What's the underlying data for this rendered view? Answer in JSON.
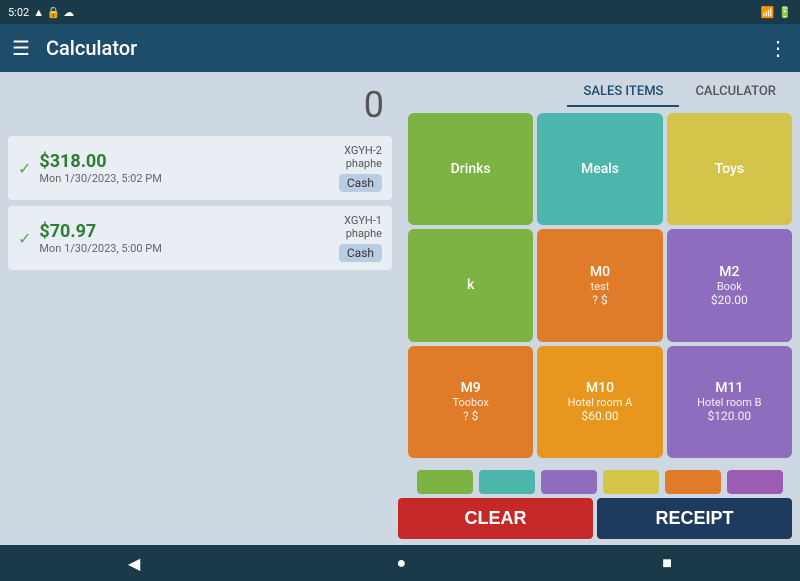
{
  "statusBar": {
    "time": "5:02",
    "batteryIcon": "🔋"
  },
  "topBar": {
    "title": "Calculator",
    "menuIcon": "☰",
    "moreIcon": "⋮"
  },
  "display": {
    "amount": "0"
  },
  "transactions": [
    {
      "amount": "$318.00",
      "date": "Mon 1/30/2023, 5:02 PM",
      "id": "XGYH-2",
      "user": "phaphe",
      "payment": "Cash"
    },
    {
      "amount": "$70.97",
      "date": "Mon 1/30/2023, 5:00 PM",
      "id": "XGYH-1",
      "user": "phaphe",
      "payment": "Cash"
    }
  ],
  "tabs": [
    {
      "label": "SALES ITEMS",
      "active": true
    },
    {
      "label": "CALCULATOR",
      "active": false
    }
  ],
  "salesItems": [
    {
      "name": "Drinks",
      "code": "",
      "price": "",
      "note": "",
      "color": "item-green",
      "row": 1,
      "col": 1
    },
    {
      "name": "Meals",
      "code": "",
      "price": "",
      "note": "",
      "color": "item-teal",
      "row": 1,
      "col": 2
    },
    {
      "name": "Toys",
      "code": "",
      "price": "",
      "note": "",
      "color": "item-yellow",
      "row": 1,
      "col": 3
    },
    {
      "name": "k",
      "code": "",
      "price": "",
      "note": "",
      "color": "item-green2",
      "row": 2,
      "col": 1
    },
    {
      "name": "M0",
      "code": "test",
      "price": "? $",
      "note": "",
      "color": "item-orange",
      "row": 2,
      "col": 2
    },
    {
      "name": "M2",
      "code": "Book",
      "price": "$20.00",
      "note": "",
      "color": "item-purple",
      "row": 2,
      "col": 3
    },
    {
      "name": "M9",
      "code": "Toobox",
      "price": "? $",
      "note": "",
      "color": "item-orange3",
      "row": 3,
      "col": 1
    },
    {
      "name": "M10",
      "code": "Hotel room A",
      "price": "$60.00",
      "note": "",
      "color": "item-orange2",
      "row": 3,
      "col": 2
    },
    {
      "name": "M11",
      "code": "Hotel room B",
      "price": "$120.00",
      "note": "",
      "color": "item-purple",
      "row": 3,
      "col": 3
    }
  ],
  "colorDots": [
    "#7cb342",
    "#4db6ac",
    "#8e6dbf",
    "#d4c44a",
    "#e07b2a",
    "#9c5cb4"
  ],
  "buttons": {
    "clear": "CLEAR",
    "receipt": "RECEIPT"
  },
  "bottomNav": {
    "back": "◀",
    "home": "●",
    "recent": "■"
  }
}
